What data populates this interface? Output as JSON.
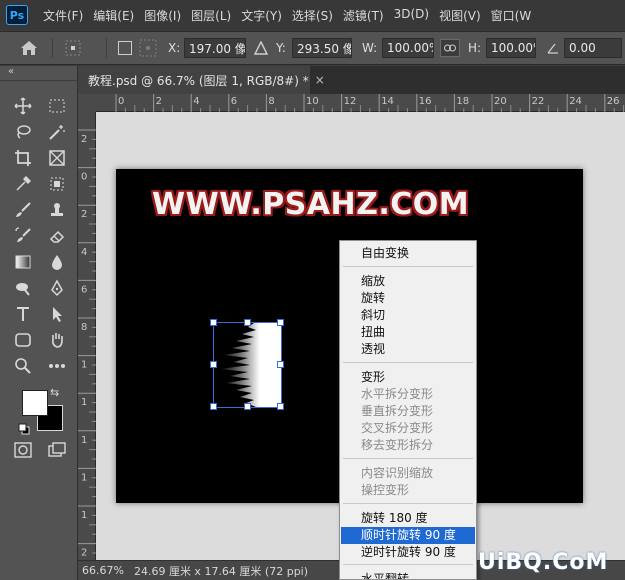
{
  "app": {
    "logo_text": "Ps"
  },
  "menubar": {
    "items": [
      "文件(F)",
      "编辑(E)",
      "图像(I)",
      "图层(L)",
      "文字(Y)",
      "选择(S)",
      "滤镜(T)",
      "3D(D)",
      "视图(V)",
      "窗口(W"
    ]
  },
  "options": {
    "x_label": "X:",
    "x_value": "197.00 像素",
    "y_label": "Y:",
    "y_value": "293.50 像素",
    "w_label": "W:",
    "w_value": "100.00%",
    "h_label": "H:",
    "h_value": "100.00%",
    "angle_value": "0.00"
  },
  "tab": {
    "title": "教程.psd @ 66.7% (图层 1, RGB/8#) *",
    "close": "×"
  },
  "rulers": {
    "top": [
      "0",
      "2",
      "4",
      "6",
      "8",
      "10",
      "12",
      "14",
      "16",
      "18",
      "20",
      "22",
      "24",
      "26"
    ],
    "left": [
      "2",
      "0",
      "2",
      "4",
      "6",
      "8",
      "1",
      "1",
      "1",
      "1",
      "1",
      "2"
    ]
  },
  "canvas": {
    "title_text": "WWW.PSAHZ.COM"
  },
  "context_menu": {
    "items": [
      {
        "label": "自由变换",
        "enabled": true
      },
      {
        "label": "缩放",
        "enabled": true
      },
      {
        "label": "旋转",
        "enabled": true
      },
      {
        "label": "斜切",
        "enabled": true
      },
      {
        "label": "扭曲",
        "enabled": true
      },
      {
        "label": "透视",
        "enabled": true
      },
      {
        "label": "变形",
        "enabled": true
      },
      {
        "label": "水平拆分变形",
        "enabled": false
      },
      {
        "label": "垂直拆分变形",
        "enabled": false
      },
      {
        "label": "交叉拆分变形",
        "enabled": false
      },
      {
        "label": "移去变形拆分",
        "enabled": false
      },
      {
        "label": "内容识别缩放",
        "enabled": false
      },
      {
        "label": "操控变形",
        "enabled": false
      },
      {
        "label": "旋转 180 度",
        "enabled": true
      },
      {
        "label": "顺时针旋转 90 度",
        "enabled": true,
        "highlighted": true
      },
      {
        "label": "逆时针旋转 90 度",
        "enabled": true
      },
      {
        "label": "水平翻转",
        "enabled": true
      }
    ]
  },
  "status": {
    "zoom": "66.67%",
    "doc_size": "24.69 厘米 x 17.64 厘米 (72 ppi)"
  },
  "watermark": {
    "text": "UiBQ.CoM"
  },
  "colors": {
    "accent": "#1f69d2",
    "foreground": "#ffffff",
    "background": "#000000"
  }
}
